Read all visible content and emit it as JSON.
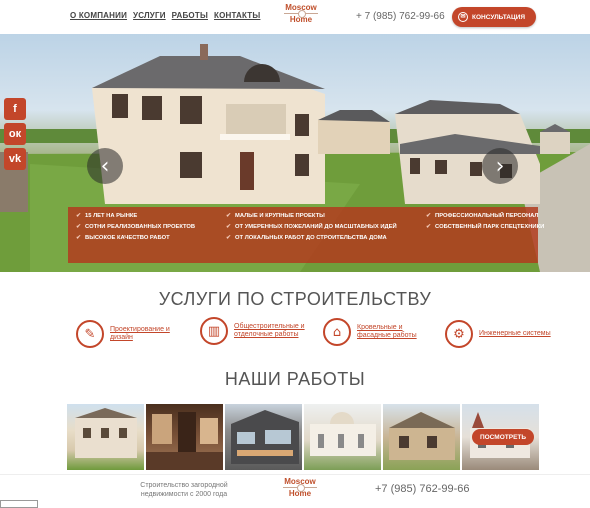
{
  "header": {
    "nav": [
      "О КОМПАНИИ",
      "УСЛУГИ",
      "РАБОТЫ",
      "КОНТАКТЫ"
    ],
    "logo_line1": "Moscow",
    "logo_line2": "Home",
    "phone": "+ 7 (985) 762-99-66",
    "consult_label": "КОНСУЛЬТАЦИЯ"
  },
  "social": {
    "facebook": "f",
    "ok": "ок",
    "vk": "vk"
  },
  "features": {
    "col1": [
      "15 ЛЕТ НА РЫНКЕ",
      "СОТНИ РЕАЛИЗОВАННЫХ ПРОЕКТОВ",
      "ВЫСОКОЕ КАЧЕСТВО РАБОТ"
    ],
    "col2": [
      "МАЛЫЕ И КРУПНЫЕ ПРОЕКТЫ",
      "ОТ УМЕРЕННЫХ ПОЖЕЛАНИЙ ДО МАСШТАБНЫХ ИДЕЙ",
      "ОТ ЛОКАЛЬНЫХ РАБОТ ДО СТРОИТЕЛЬСТВА ДОМА"
    ],
    "col3": [
      "ПРОФЕССИОНАЛЬНЫЙ ПЕРСОНАЛ",
      "СОБСТВЕННЫЙ ПАРК СПЕЦТЕХНИКИ"
    ]
  },
  "services": {
    "title": "УСЛУГИ ПО СТРОИТЕЛЬСТВУ",
    "items": [
      {
        "label": "Проектирование и дизайн",
        "icon": "drafting-icon"
      },
      {
        "label": "Общестроительные и отделочные работы",
        "icon": "paint-roller-icon"
      },
      {
        "label": "Кровельные и фасадные работы",
        "icon": "roof-icon"
      },
      {
        "label": "Инженерные системы",
        "icon": "engineering-icon"
      }
    ]
  },
  "works": {
    "title": "НАШИ РАБОТЫ",
    "more_label": "ПОСМОТРЕТЬ"
  },
  "footer": {
    "note": "Строительство загородной недвижимости с 2000 года",
    "phone": "+7 (985) 762-99-66"
  },
  "colors": {
    "accent": "#c3462a"
  }
}
